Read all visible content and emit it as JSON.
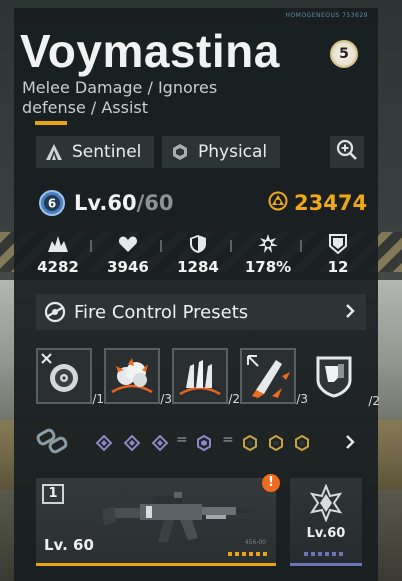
{
  "header": {
    "corner_code": "HOMOGENEOUS 753629",
    "name": "Voymastina",
    "rarity": "5",
    "subtitle": "Melee Damage / Ignores defense / Assist"
  },
  "tags": [
    {
      "label": "Sentinel",
      "icon": "sentinel-icon"
    },
    {
      "label": "Physical",
      "icon": "physical-icon"
    }
  ],
  "level": {
    "badge": "6",
    "current": "Lv.60",
    "separator": "/",
    "max": "60"
  },
  "power": {
    "value": "23474",
    "icon": "power-icon"
  },
  "stats": [
    {
      "icon": "attack-icon",
      "value": "4282"
    },
    {
      "icon": "health-icon",
      "value": "3946"
    },
    {
      "icon": "defense-icon",
      "value": "1284"
    },
    {
      "icon": "crit-damage-icon",
      "value": "178%"
    },
    {
      "icon": "endurance-icon",
      "value": "12"
    }
  ],
  "fire_control": {
    "label": "Fire Control Presets",
    "icon": "fire-control-icon"
  },
  "skills": [
    {
      "icon": "target-skill-icon",
      "level": "/1"
    },
    {
      "icon": "explosion-skill-icon",
      "level": "/3"
    },
    {
      "icon": "bullets-skill-icon",
      "level": "/2"
    },
    {
      "icon": "missile-skill-icon",
      "level": "/3"
    },
    {
      "icon": "shield-skill-icon",
      "level": "/2"
    }
  ],
  "chain": {
    "equals_1": "=",
    "equals_2": "="
  },
  "weapon": {
    "slot": "1",
    "level": "Lv. 60",
    "code": "456-00",
    "alert": "!"
  },
  "core": {
    "level": "Lv.60"
  },
  "colors": {
    "accent": "#e8a413",
    "power": "#f0a818",
    "alert": "#f06a1f",
    "core_bar": "#6a74b8"
  }
}
